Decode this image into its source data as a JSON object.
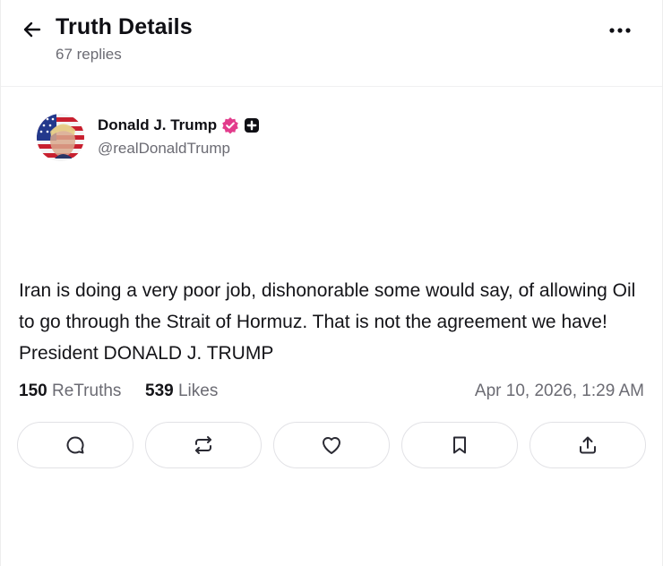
{
  "header": {
    "title": "Truth Details",
    "replies": "67 replies"
  },
  "author": {
    "name": "Donald J. Trump",
    "handle": "@realDonaldTrump",
    "verified_color": "#e23c8c"
  },
  "post": {
    "text": "Iran is doing a very poor job, dishonorable some would say, of allowing Oil to go through the Strait of Hormuz. That is not the agreement we have! President DONALD J. TRUMP"
  },
  "stats": {
    "retruths_count": "150",
    "retruths_label": "ReTruths",
    "likes_count": "539",
    "likes_label": "Likes",
    "timestamp": "Apr 10, 2026, 1:29 AM"
  },
  "actions": [
    "reply-icon",
    "retruth-icon",
    "like-icon",
    "bookmark-icon",
    "share-icon"
  ]
}
